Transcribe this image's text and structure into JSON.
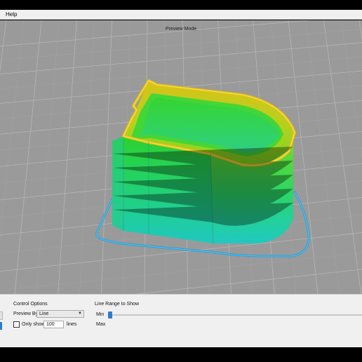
{
  "menubar": {
    "items": [
      {
        "label": "Help"
      }
    ]
  },
  "viewport": {
    "mode_label": "Preview Mode",
    "background_color": "#9a9a9a",
    "grid_color": "#b4b4b4",
    "model_gradient": [
      "#22cbbd",
      "#1fd58c",
      "#41d94a",
      "#98d61e",
      "#e0c40e"
    ],
    "skirt_color": "#2a9fd8"
  },
  "control_options": {
    "title": "Control Options",
    "preview_by_label": "Preview By",
    "preview_by_value": "Line",
    "only_show_label": "Only show",
    "only_show_checked": false,
    "only_show_value": "100",
    "lines_label": "lines"
  },
  "line_range": {
    "title": "Line Range to Show",
    "min_label": "Min",
    "max_label": "Max",
    "min_position": 0
  }
}
